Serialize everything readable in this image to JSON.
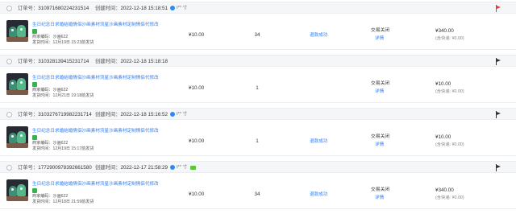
{
  "labels": {
    "order_no": "订单号：",
    "created": "创建时间：",
    "merchant_code": "商家编码：",
    "ship_time": "发货时间："
  },
  "orders": [
    {
      "order_no": "3109716802242315​14",
      "created": "2022-12-18 15:18:51",
      "user": "t** 寸",
      "has_green_badge": false,
      "flag_color": "#e8383d",
      "title": "生日纪念日求婚结婚情侣沙画素材流星沙画素材定制情侣代修改",
      "merchant_code": "沙画622",
      "ship_time": "12月19日 15:23前发货",
      "price": "¥10.00",
      "qty": "34",
      "refund": "退款成功",
      "status": "交易关闭",
      "detail": "详情",
      "amount": "¥340.00",
      "shipping": "(含快递: ¥0.00)"
    },
    {
      "order_no": "3103281394152317​14",
      "created": "2022-12-18 15:18:18",
      "user": "",
      "has_green_badge": false,
      "flag_color": "#333333",
      "title": "生日纪念日求婚结婚情侣沙画素材流星沙画素材定制情侣代修改",
      "merchant_code": "沙画622",
      "ship_time": "12月21日 19:18前发货",
      "price": "¥10.00",
      "qty": "1",
      "refund": "",
      "status": "交易关闭",
      "detail": "详情",
      "amount": "¥10.00",
      "shipping": "(含快递: ¥0.00)"
    },
    {
      "order_no": "3103276719982231714",
      "created": "2022-12-18 15:16:52",
      "user": "t** 寸",
      "has_green_badge": false,
      "flag_color": "#333333",
      "title": "生日纪念日求婚结婚情侣沙画素材流星沙画素材定制情侣代修改",
      "merchant_code": "沙画622",
      "ship_time": "12月19日 15:17前发货",
      "price": "¥10.00",
      "qty": "1",
      "refund": "退款成功",
      "status": "交易关闭",
      "detail": "详情",
      "amount": "¥10.00",
      "shipping": "(含快递: ¥0.00)"
    },
    {
      "order_no": "1772900978392661580",
      "created": "2022-12-17 21:58:29",
      "user": "t** 寸",
      "has_green_badge": true,
      "flag_color": "#333333",
      "title": "生日纪念日求婚结婚情侣沙画素材流星沙画素材定制情侣代修改",
      "merchant_code": "沙画622",
      "ship_time": "12月18日 21:59前发货",
      "price": "¥10.00",
      "qty": "34",
      "refund": "退款成功",
      "status": "交易关闭",
      "detail": "详情",
      "amount": "¥340.00",
      "shipping": "(含快递: ¥0.00)"
    }
  ]
}
